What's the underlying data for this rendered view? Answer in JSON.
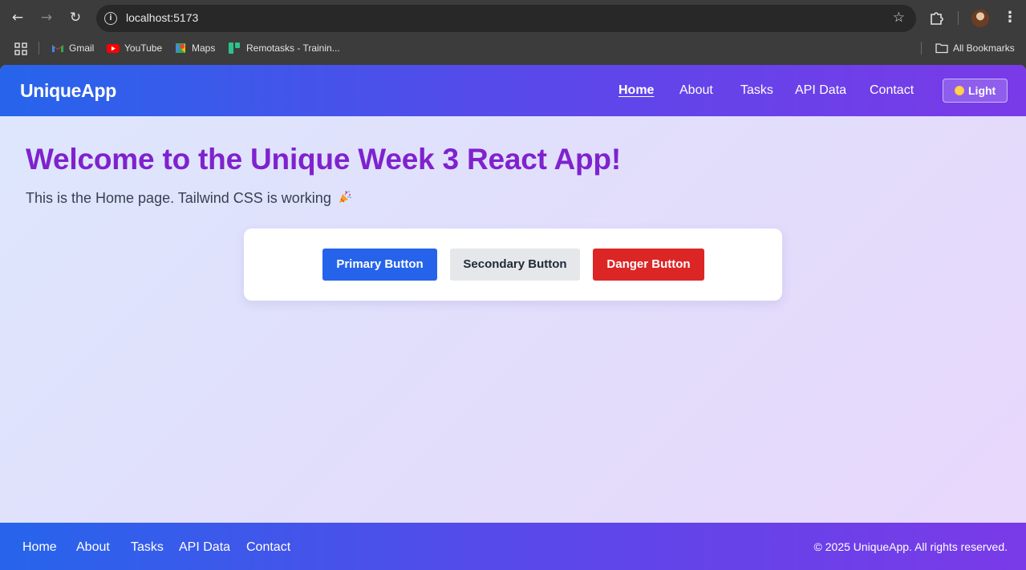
{
  "browser": {
    "url": "localhost:5173",
    "bookmarks": [
      {
        "label": "Gmail",
        "icon": "gmail-icon"
      },
      {
        "label": "YouTube",
        "icon": "youtube-icon"
      },
      {
        "label": "Maps",
        "icon": "maps-icon"
      },
      {
        "label": "Remotasks - Trainin...",
        "icon": "remotasks-icon"
      }
    ],
    "all_bookmarks_label": "All Bookmarks"
  },
  "header": {
    "brand": "UniqueApp",
    "nav": [
      {
        "label": "Home",
        "active": true
      },
      {
        "label": "About",
        "active": false
      },
      {
        "label": "Tasks",
        "active": false
      },
      {
        "label": "API Data",
        "active": false
      },
      {
        "label": "Contact",
        "active": false
      }
    ],
    "theme_toggle_label": "Light",
    "theme_toggle_icon": "sun-icon"
  },
  "main": {
    "title": "Welcome to the Unique Week 3 React App!",
    "subtitle": "This is the Home page. Tailwind CSS is working",
    "subtitle_icon": "party-popper-icon",
    "buttons": {
      "primary": "Primary Button",
      "secondary": "Secondary Button",
      "danger": "Danger Button"
    }
  },
  "footer": {
    "nav": [
      "Home",
      "About",
      "Tasks",
      "API Data",
      "Contact"
    ],
    "copyright": "© 2025 UniqueApp. All rights reserved."
  },
  "colors": {
    "header_gradient_start": "#2665eb",
    "header_gradient_end": "#7a3ae8",
    "title_color": "#7f22ce",
    "primary": "#2563eb",
    "secondary": "#e5e7eb",
    "danger": "#dc2626"
  }
}
